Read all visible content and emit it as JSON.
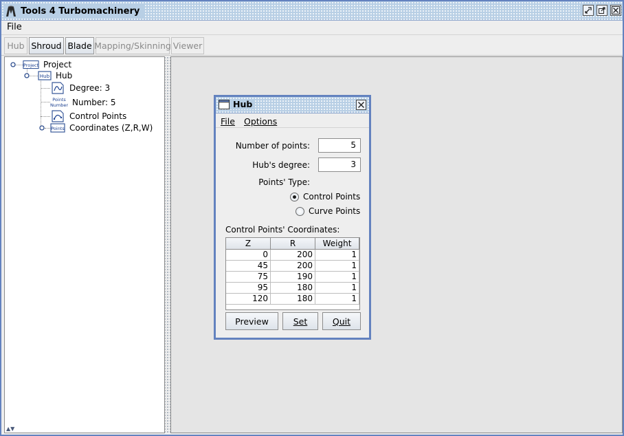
{
  "window": {
    "title": "Tools 4 Turbomachinery"
  },
  "menubar": {
    "file": "File"
  },
  "toolbar": {
    "buttons": [
      {
        "label": "Hub",
        "enabled": false
      },
      {
        "label": "Shroud",
        "enabled": true
      },
      {
        "label": "Blade",
        "enabled": true
      },
      {
        "label": "Mapping/Skinning",
        "enabled": false
      },
      {
        "label": "Viewer",
        "enabled": false
      }
    ]
  },
  "tree": {
    "root": "Project",
    "hub": "Hub",
    "degree": "Degree: 3",
    "number": "Number: 5",
    "control_points": "Control Points",
    "coordinates": "Coordinates (Z,R,W)",
    "icon_labels": {
      "project": "Project",
      "hub": "Hub",
      "points": "Points",
      "number": "Number"
    }
  },
  "dialog": {
    "title": "Hub",
    "menu_file": "File",
    "menu_options": "Options",
    "num_points_label": "Number of points:",
    "num_points_value": "5",
    "degree_label": "Hub's degree:",
    "degree_value": "3",
    "points_type_label": "Points' Type:",
    "radio_control": "Control Points",
    "radio_curve": "Curve Points",
    "radio_selected": "Control Points",
    "coords_label": "Control Points' Coordinates:",
    "table": {
      "headers": [
        "Z",
        "R",
        "Weight"
      ],
      "rows": [
        [
          "0",
          "200",
          "1"
        ],
        [
          "45",
          "200",
          "1"
        ],
        [
          "75",
          "190",
          "1"
        ],
        [
          "95",
          "180",
          "1"
        ],
        [
          "120",
          "180",
          "1"
        ]
      ]
    },
    "buttons": {
      "preview": "Preview",
      "set": "Set",
      "quit": "Quit"
    }
  },
  "colors": {
    "frame": "#6382bf",
    "titlebar": "#b8cfe5",
    "background": "#eeeeee",
    "desktop": "#e5e5e5"
  }
}
